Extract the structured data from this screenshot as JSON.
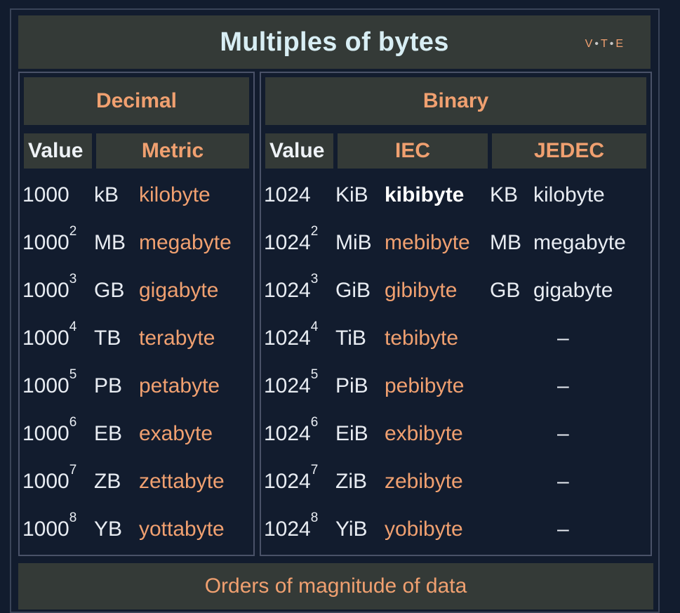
{
  "title": "Multiples of bytes",
  "vte": {
    "v": "V",
    "t": "T",
    "e": "E",
    "sep": "•"
  },
  "decimal": {
    "group_header": "Decimal",
    "col_value": "Value",
    "col_metric": "Metric",
    "rows": [
      {
        "base": "1000",
        "exp": "",
        "symbol": "kB",
        "name": "kilobyte"
      },
      {
        "base": "1000",
        "exp": "2",
        "symbol": "MB",
        "name": "megabyte"
      },
      {
        "base": "1000",
        "exp": "3",
        "symbol": "GB",
        "name": "gigabyte"
      },
      {
        "base": "1000",
        "exp": "4",
        "symbol": "TB",
        "name": "terabyte"
      },
      {
        "base": "1000",
        "exp": "5",
        "symbol": "PB",
        "name": "petabyte"
      },
      {
        "base": "1000",
        "exp": "6",
        "symbol": "EB",
        "name": "exabyte"
      },
      {
        "base": "1000",
        "exp": "7",
        "symbol": "ZB",
        "name": "zettabyte"
      },
      {
        "base": "1000",
        "exp": "8",
        "symbol": "YB",
        "name": "yottabyte"
      }
    ]
  },
  "binary": {
    "group_header": "Binary",
    "col_value": "Value",
    "col_iec": "IEC",
    "col_jedec": "JEDEC",
    "rows": [
      {
        "base": "1024",
        "exp": "",
        "iec_symbol": "KiB",
        "iec_name": "kibibyte",
        "jedec_symbol": "KB",
        "jedec_name": "kilobyte"
      },
      {
        "base": "1024",
        "exp": "2",
        "iec_symbol": "MiB",
        "iec_name": "mebibyte",
        "jedec_symbol": "MB",
        "jedec_name": "megabyte"
      },
      {
        "base": "1024",
        "exp": "3",
        "iec_symbol": "GiB",
        "iec_name": "gibibyte",
        "jedec_symbol": "GB",
        "jedec_name": "gigabyte"
      },
      {
        "base": "1024",
        "exp": "4",
        "iec_symbol": "TiB",
        "iec_name": "tebibyte",
        "jedec_dash": "–"
      },
      {
        "base": "1024",
        "exp": "5",
        "iec_symbol": "PiB",
        "iec_name": "pebibyte",
        "jedec_dash": "–"
      },
      {
        "base": "1024",
        "exp": "6",
        "iec_symbol": "EiB",
        "iec_name": "exbibyte",
        "jedec_dash": "–"
      },
      {
        "base": "1024",
        "exp": "7",
        "iec_symbol": "ZiB",
        "iec_name": "zebibyte",
        "jedec_dash": "–"
      },
      {
        "base": "1024",
        "exp": "8",
        "iec_symbol": "YiB",
        "iec_name": "yobibyte",
        "jedec_dash": "–"
      }
    ]
  },
  "footer": "Orders of magnitude of data",
  "colors": {
    "background": "#121c2e",
    "header_bg": "#343a37",
    "link": "#f0a070",
    "title": "#d8eef4"
  }
}
